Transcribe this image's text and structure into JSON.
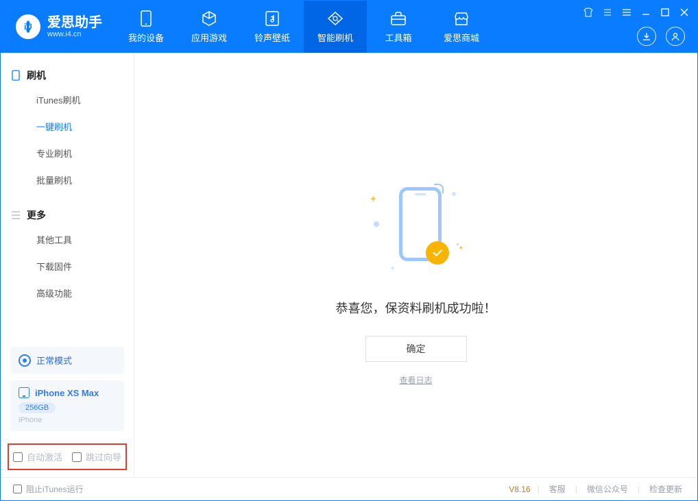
{
  "brand": {
    "name": "爱思助手",
    "url": "www.i4.cn"
  },
  "tabs": [
    {
      "label": "我的设备",
      "icon": "device-icon"
    },
    {
      "label": "应用游戏",
      "icon": "cube-icon"
    },
    {
      "label": "铃声壁纸",
      "icon": "music-icon"
    },
    {
      "label": "智能刷机",
      "icon": "refresh-icon",
      "active": true
    },
    {
      "label": "工具箱",
      "icon": "toolbox-icon"
    },
    {
      "label": "爱思商城",
      "icon": "shop-icon"
    }
  ],
  "sidebar": {
    "group1": {
      "title": "刷机",
      "items": [
        {
          "label": "iTunes刷机"
        },
        {
          "label": "一键刷机",
          "active": true
        },
        {
          "label": "专业刷机"
        },
        {
          "label": "批量刷机"
        }
      ]
    },
    "group2": {
      "title": "更多",
      "items": [
        {
          "label": "其他工具"
        },
        {
          "label": "下载固件"
        },
        {
          "label": "高级功能"
        }
      ]
    },
    "mode": "正常模式",
    "device": {
      "name": "iPhone XS Max",
      "capacity": "256GB",
      "type": "iPhone"
    },
    "options": {
      "opt1": "自动激活",
      "opt2": "跳过向导"
    }
  },
  "main": {
    "message": "恭喜您，保资料刷机成功啦！",
    "confirm": "确定",
    "log_link": "查看日志"
  },
  "status": {
    "block_itunes": "阻止iTunes运行",
    "version": "V8.16",
    "links": [
      "客服",
      "微信公众号",
      "检查更新"
    ]
  }
}
